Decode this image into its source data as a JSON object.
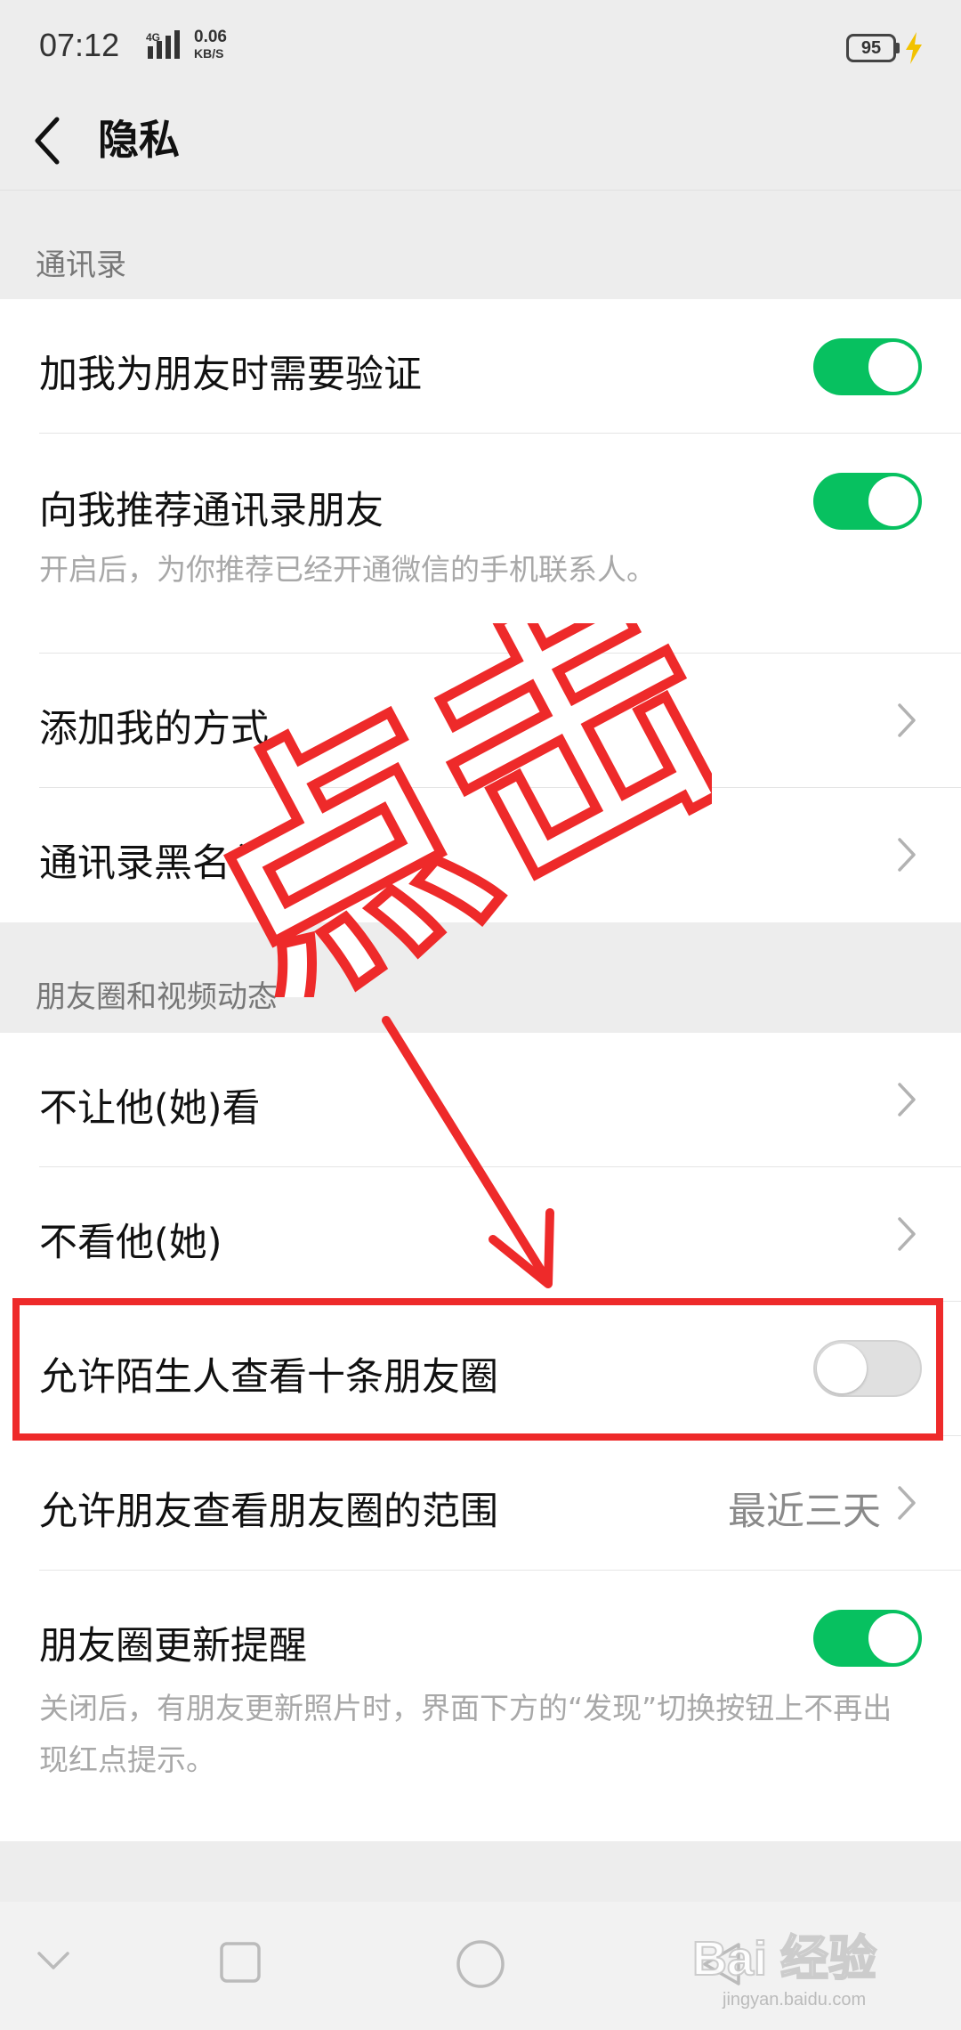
{
  "status_bar": {
    "time": "07:12",
    "network": "4G",
    "speed_value": "0.06",
    "speed_unit": "KB/S",
    "battery": "95"
  },
  "header": {
    "title": "隐私"
  },
  "sections": {
    "contacts": {
      "header": "通讯录",
      "verify_label": "加我为朋友时需要验证",
      "verify_on": true,
      "recommend_label": "向我推荐通讯录朋友",
      "recommend_desc": "开启后，为你推荐已经开通微信的手机联系人。",
      "recommend_on": true,
      "add_methods_label": "添加我的方式",
      "blacklist_label": "通讯录黑名单"
    },
    "moments": {
      "header": "朋友圈和视频动态",
      "hide_my_posts_label": "不让他(她)看",
      "hide_their_posts_label": "不看他(她)",
      "stranger_view_label": "允许陌生人查看十条朋友圈",
      "stranger_view_on": false,
      "visible_range_label": "允许朋友查看朋友圈的范围",
      "visible_range_value": "最近三天",
      "update_reminder_label": "朋友圈更新提醒",
      "update_reminder_desc": "关闭后，有朋友更新照片时，界面下方的“发现”切换按钮上不再出现红点提示。",
      "update_reminder_on": true
    }
  },
  "annotation": {
    "text": "点击",
    "color": "#ee2a2a"
  },
  "watermark": {
    "text": "Bai 经验",
    "url_text": "jingyan.baidu.com"
  },
  "colors": {
    "toggle_on": "#07c160",
    "toggle_off": "#e0e0e0",
    "background": "#ededed"
  }
}
